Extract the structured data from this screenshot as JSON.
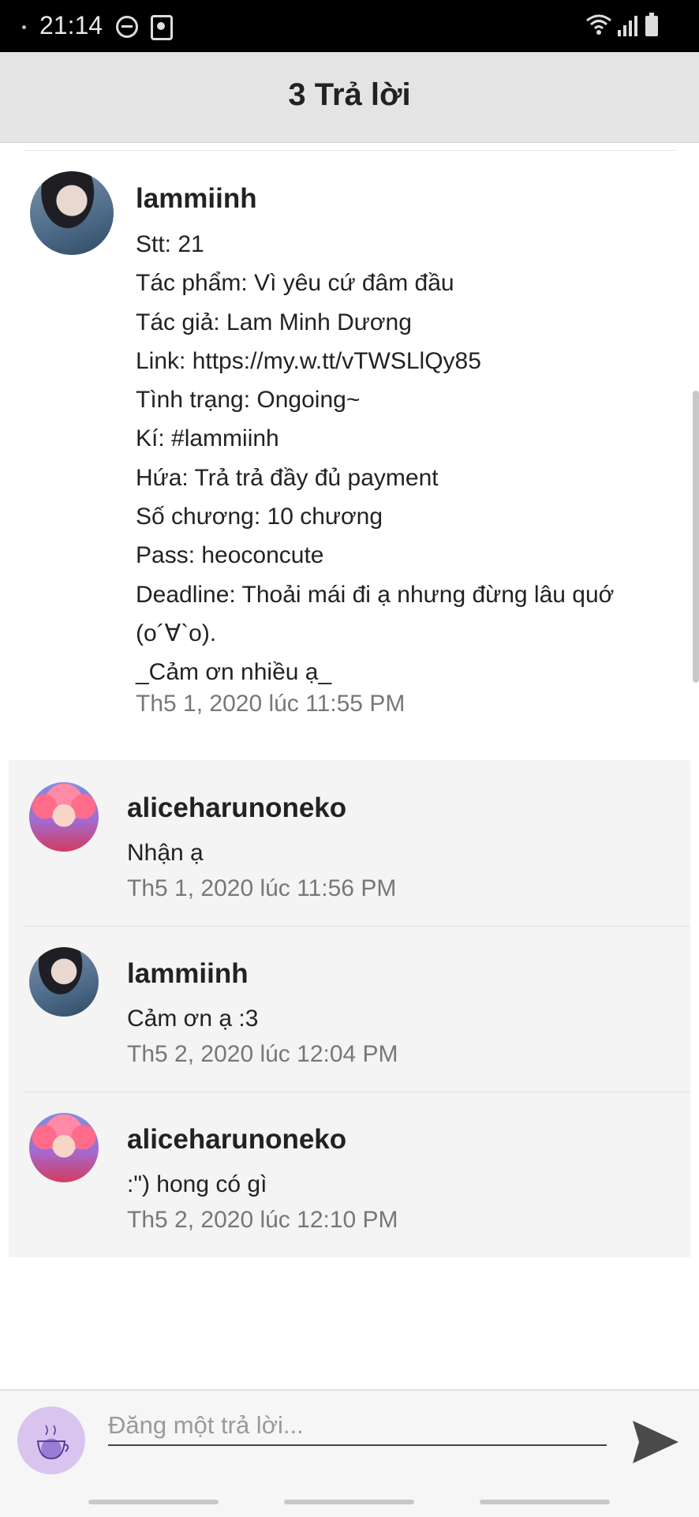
{
  "status_bar": {
    "time": "21:14",
    "icons": [
      "dnd-icon",
      "app-icon",
      "wifi-icon",
      "signal-icon",
      "battery-icon"
    ]
  },
  "header": {
    "title": "3 Trả lời"
  },
  "post": {
    "username": "lammiinh",
    "lines": [
      "Stt: 21",
      "Tác phẩm: Vì yêu cứ đâm đầu",
      "Tác giả: Lam Minh Dương",
      "Link: https://my.w.tt/vTWSLlQy85",
      "Tình trạng: Ongoing~",
      "Kí: #lammiinh",
      "Hứa: Trả trả đầy đủ payment",
      "Số chương: 10 chương",
      "Pass: heoconcute",
      "Deadline: Thoải mái đi ạ nhưng đừng lâu quớ",
      "(o´∀`o).",
      "_Cảm ơn nhiều ạ_"
    ],
    "timestamp": "Th5 1, 2020 lúc 11:55 PM"
  },
  "replies": [
    {
      "username": "aliceharunoneko",
      "text": "Nhận ạ",
      "timestamp": "Th5 1, 2020 lúc 11:56 PM"
    },
    {
      "username": "lammiinh",
      "text": "Cảm ơn ạ :3",
      "timestamp": "Th5 2, 2020 lúc 12:04 PM"
    },
    {
      "username": "aliceharunoneko",
      "text": ":\") hong có gì",
      "timestamp": "Th5 2, 2020 lúc 12:10 PM"
    }
  ],
  "composer": {
    "placeholder": "Đăng một trả lời..."
  }
}
